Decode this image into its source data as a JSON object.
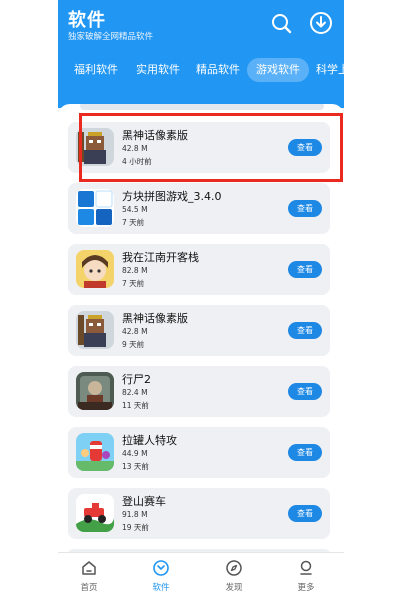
{
  "header": {
    "title": "软件",
    "subtitle": "独家破解全网精品软件",
    "search_icon": "search-icon",
    "download_icon": "download-icon",
    "color": "#2196f3"
  },
  "tabs": [
    {
      "label": "福利软件",
      "active": false
    },
    {
      "label": "实用软件",
      "active": false
    },
    {
      "label": "精品软件",
      "active": false
    },
    {
      "label": "游戏软件",
      "active": true
    },
    {
      "label": "科学上",
      "active": false
    }
  ],
  "apps": [
    {
      "name": "黑神话像素版",
      "size": "42.8 M",
      "time": "4 小时前",
      "button": "查看",
      "icon": "wukong-pixel-icon"
    },
    {
      "name": "方块拼图游戏_3.4.0",
      "size": "54.5 M",
      "time": "7 天前",
      "button": "查看",
      "icon": "block-puzzle-icon"
    },
    {
      "name": "我在江南开客栈",
      "size": "82.8 M",
      "time": "7 天前",
      "button": "查看",
      "icon": "inn-girl-icon"
    },
    {
      "name": "黑神话像素版",
      "size": "42.8 M",
      "time": "9 天前",
      "button": "查看",
      "icon": "wukong-pixel-icon"
    },
    {
      "name": "行尸2",
      "size": "82.4 M",
      "time": "11 天前",
      "button": "查看",
      "icon": "walking-dead-icon"
    },
    {
      "name": "拉罐人特攻",
      "size": "44.9 M",
      "time": "13 天前",
      "button": "查看",
      "icon": "can-man-icon"
    },
    {
      "name": "登山赛车",
      "size": "91.8 M",
      "time": "19 天前",
      "button": "查看",
      "icon": "hill-climb-car-icon"
    }
  ],
  "highlight_color": "#ea2a1f",
  "bottom_nav": [
    {
      "label": "首页",
      "icon": "home-icon",
      "active": false
    },
    {
      "label": "软件",
      "icon": "software-icon",
      "active": true
    },
    {
      "label": "发现",
      "icon": "compass-icon",
      "active": false
    },
    {
      "label": "更多",
      "icon": "more-icon",
      "active": false
    }
  ]
}
